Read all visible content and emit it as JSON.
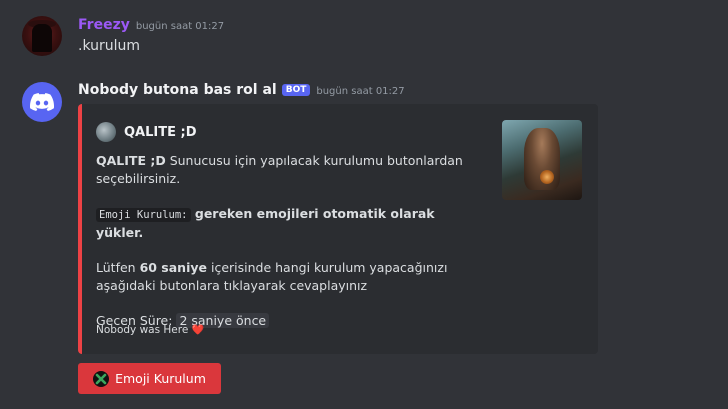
{
  "messages": [
    {
      "username": "Freezy",
      "username_color": "#9b59f5",
      "timestamp": "bugün saat 01:27",
      "content": ".kurulum"
    },
    {
      "username": "Nobody butona bas rol al",
      "username_color": "#f2f3f5",
      "bot_badge": "BOT",
      "timestamp": "bugün saat 01:27",
      "embed": {
        "accent_color": "#ed4245",
        "author": "QALITE ;D",
        "line1_bold": "QALITE ;D",
        "line1_rest": " Sunucusu için yapılacak kurulumu butonlardan seçebilirsiniz.",
        "line2_code": "Emoji Kurulum:",
        "line2_bold": " gereken emojileri otomatik olarak yükler.",
        "line3_pre": "Lütfen ",
        "line3_bold": "60 saniye",
        "line3_post": " içerisinde hangi kurulum yapacağınızı aşağıdaki butonlara tıklayarak cevaplayınız",
        "line4_label": "Gecen Süre: ",
        "line4_value": "2 saniye önce",
        "footer_text": "Nobody was Here",
        "footer_emoji": "❤️"
      },
      "button": {
        "label": "Emoji Kurulum",
        "color": "#da373c",
        "icon": "x-emoji-icon"
      }
    }
  ]
}
